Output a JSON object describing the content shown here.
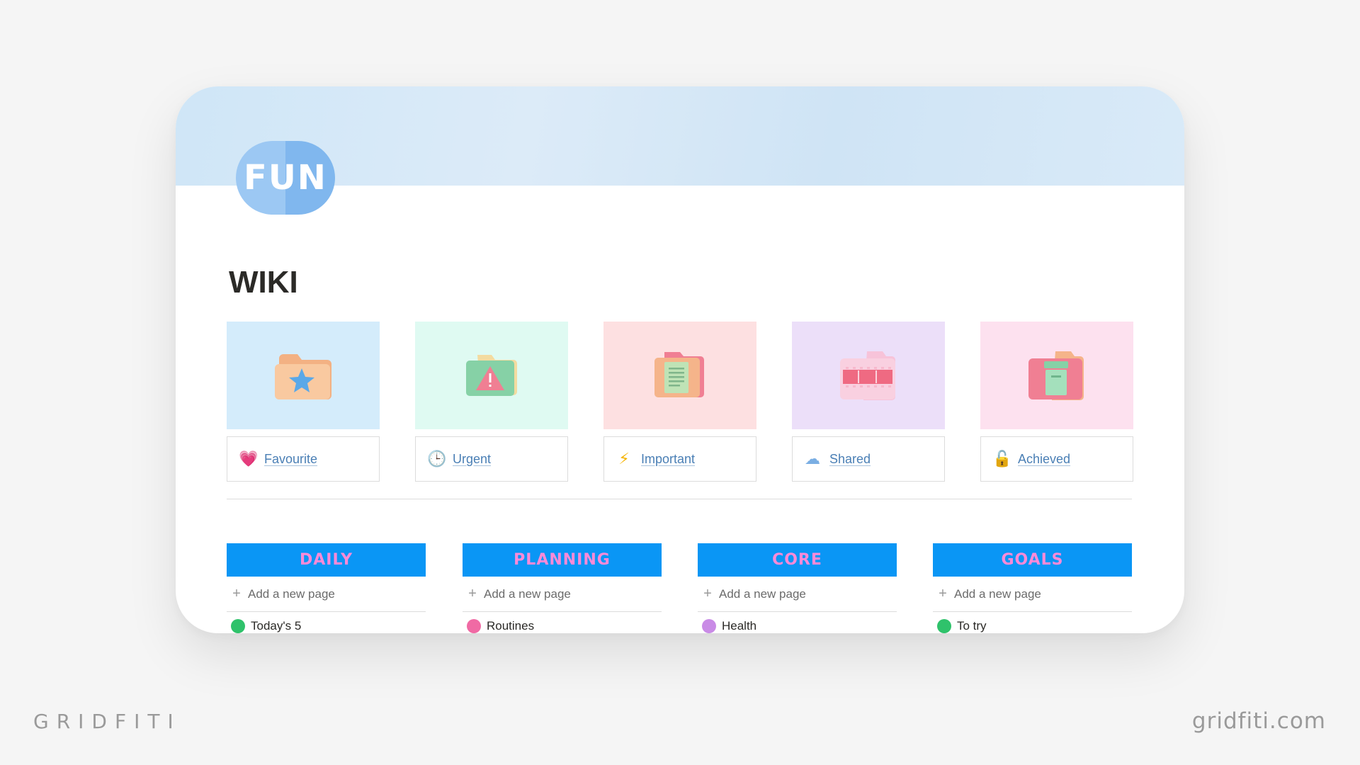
{
  "header": {
    "badge_text": "FUN",
    "title": "WIKI"
  },
  "gallery": [
    {
      "label": "Favourite",
      "emoji": "💗",
      "thumb_bg": "#d4ecfb",
      "icon": "star-folder-icon"
    },
    {
      "label": "Urgent",
      "emoji": "🕒",
      "thumb_bg": "#dffaf2",
      "icon": "warning-folder-icon"
    },
    {
      "label": "Important",
      "emoji": "⚡",
      "thumb_bg": "#fde0e1",
      "icon": "document-folder-icon"
    },
    {
      "label": "Shared",
      "emoji": "☁",
      "thumb_bg": "#ecdff9",
      "icon": "film-folder-icon"
    },
    {
      "label": "Achieved",
      "emoji": "🔓",
      "thumb_bg": "#fde1ef",
      "icon": "archive-folder-icon"
    }
  ],
  "boards": [
    {
      "title": "DAILY",
      "add_label": "Add a new page",
      "first_item": "Today's 5",
      "dot_color": "#2fc26b"
    },
    {
      "title": "PLANNING",
      "add_label": "Add a new page",
      "first_item": "Routines",
      "dot_color": "#f06aa4"
    },
    {
      "title": "CORE",
      "add_label": "Add a new page",
      "first_item": "Health",
      "dot_color": "#c98be6"
    },
    {
      "title": "GOALS",
      "add_label": "Add a new page",
      "first_item": "To try",
      "dot_color": "#2fc26b"
    }
  ],
  "watermark": {
    "left": "GRIDFITI",
    "right": "gridfiti.com"
  },
  "colors": {
    "board_header_bg": "#0a96f5",
    "board_header_text": "#ff8ad8",
    "link": "#4a7fb5"
  }
}
